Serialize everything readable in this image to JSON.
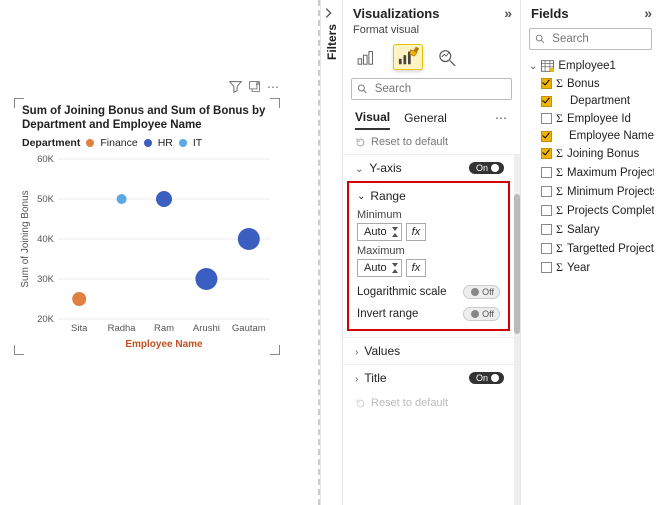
{
  "panels": {
    "filters_label": "Filters",
    "viz_title": "Visualizations",
    "viz_sub": "Format visual",
    "fields_title": "Fields"
  },
  "search": {
    "placeholder": "Search"
  },
  "tabs": {
    "visual": "Visual",
    "general": "General"
  },
  "reset": "Reset to default",
  "sections": {
    "yaxis": "Y-axis",
    "range": "Range",
    "values": "Values",
    "title": "Title"
  },
  "range": {
    "min_label": "Minimum",
    "max_label": "Maximum",
    "auto": "Auto",
    "fx": "fx",
    "log": "Logarithmic scale",
    "invert": "Invert range"
  },
  "toggle_text": {
    "on": "On",
    "off": "Off"
  },
  "fields_tree": {
    "table": "Employee1",
    "items": [
      {
        "label": "Bonus",
        "checked": true,
        "sigma": true
      },
      {
        "label": "Department",
        "checked": true,
        "sigma": false
      },
      {
        "label": "Employee Id",
        "checked": false,
        "sigma": true
      },
      {
        "label": "Employee Name",
        "checked": true,
        "sigma": false
      },
      {
        "label": "Joining Bonus",
        "checked": true,
        "sigma": true
      },
      {
        "label": "Maximum Projects",
        "checked": false,
        "sigma": true
      },
      {
        "label": "Minimum Projects",
        "checked": false,
        "sigma": true
      },
      {
        "label": "Projects Complet...",
        "checked": false,
        "sigma": true
      },
      {
        "label": "Salary",
        "checked": false,
        "sigma": true
      },
      {
        "label": "Targetted Projects",
        "checked": false,
        "sigma": true
      },
      {
        "label": "Year",
        "checked": false,
        "sigma": true
      }
    ]
  },
  "chart": {
    "title": "Sum of Joining Bonus and Sum of Bonus by Department and Employee Name",
    "legend_label": "Department",
    "legend": [
      {
        "name": "Finance",
        "color": "#e08040"
      },
      {
        "name": "HR",
        "color": "#3b5fc0"
      },
      {
        "name": "IT",
        "color": "#5aa9e6"
      }
    ],
    "xlabel": "Employee Name",
    "ylabel": "Sum of Joining Bonus"
  },
  "chart_data": {
    "type": "scatter",
    "xlabel": "Employee Name",
    "ylabel": "Sum of Joining Bonus",
    "ylim": [
      20000,
      60000
    ],
    "yticks": [
      "20K",
      "30K",
      "40K",
      "50K",
      "60K"
    ],
    "categories": [
      "Sita",
      "Radha",
      "Ram",
      "Arushi",
      "Gautam"
    ],
    "points": [
      {
        "x": "Sita",
        "y": 25000,
        "dept": "Finance",
        "size": 14
      },
      {
        "x": "Radha",
        "y": 50000,
        "dept": "IT",
        "size": 10
      },
      {
        "x": "Ram",
        "y": 50000,
        "dept": "HR",
        "size": 16
      },
      {
        "x": "Arushi",
        "y": 30000,
        "dept": "HR",
        "size": 22
      },
      {
        "x": "Gautam",
        "y": 40000,
        "dept": "HR",
        "size": 22
      }
    ]
  }
}
